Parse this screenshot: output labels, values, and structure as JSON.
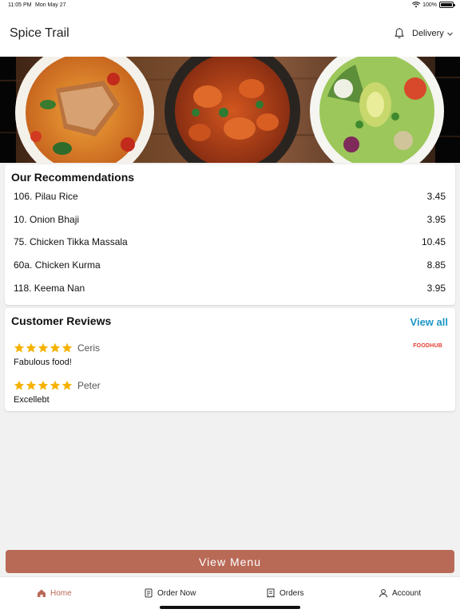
{
  "status_bar": {
    "time": "11:05 PM",
    "date": "Mon May 27",
    "battery": "100%",
    "battery_level": 1.0
  },
  "header": {
    "title": "Spice Trail",
    "delivery_label": "Delivery"
  },
  "recommendations": {
    "title": "Our Recommendations",
    "items": [
      {
        "name": "106. Pilau Rice",
        "price": "3.45"
      },
      {
        "name": "10. Onion Bhaji",
        "price": "3.95"
      },
      {
        "name": "75. Chicken Tikka Massala",
        "price": "10.45"
      },
      {
        "name": "60a. Chicken Kurma",
        "price": "8.85"
      },
      {
        "name": "118. Keema Nan",
        "price": "3.95"
      }
    ]
  },
  "reviews": {
    "title": "Customer Reviews",
    "view_all": "View all",
    "source_logo": "FOODHUB",
    "items": [
      {
        "name": "Ceris",
        "rating": 5,
        "text": "Fabulous food!"
      },
      {
        "name": "Peter",
        "rating": 5,
        "text": "Excellebt"
      }
    ]
  },
  "cta": {
    "label": "View Menu"
  },
  "tabs": [
    {
      "label": "Home",
      "icon": "home-icon",
      "active": true
    },
    {
      "label": "Order Now",
      "icon": "order-icon",
      "active": false
    },
    {
      "label": "Orders",
      "icon": "receipt-icon",
      "active": false
    },
    {
      "label": "Account",
      "icon": "user-icon",
      "active": false
    }
  ],
  "colors": {
    "accent": "#b96a57",
    "link": "#1e96c8",
    "star": "#f5b300",
    "foodhub": "#e33b2e"
  }
}
